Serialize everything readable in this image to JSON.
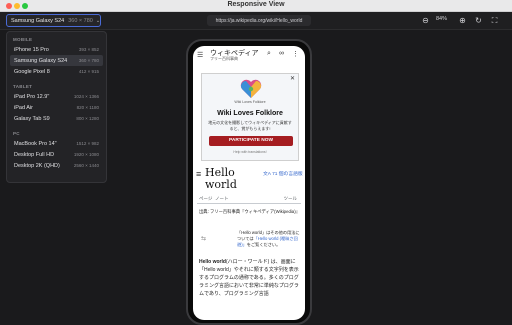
{
  "window": {
    "title": "Responsive View"
  },
  "toolbar": {
    "device_name": "Samsung Galaxy S24",
    "device_res": "360 × 780",
    "url": "https://ja.wikipedia.org/wiki/Hello_world",
    "zoom": "84%"
  },
  "dropdown": {
    "groups": [
      {
        "label": "MOBILE",
        "items": [
          {
            "name": "iPhone 15 Pro",
            "res": "393 × 852"
          },
          {
            "name": "Samsung Galaxy S24",
            "res": "360 × 780"
          },
          {
            "name": "Google Pixel 8",
            "res": "412 × 915"
          }
        ]
      },
      {
        "label": "TABLET",
        "items": [
          {
            "name": "iPad Pro 12.9\"",
            "res": "1024 × 1366"
          },
          {
            "name": "iPad Air",
            "res": "820 × 1180"
          },
          {
            "name": "Galaxy Tab S9",
            "res": "800 × 1280"
          }
        ]
      },
      {
        "label": "PC",
        "items": [
          {
            "name": "MacBook Pro 14\"",
            "res": "1512 × 982"
          },
          {
            "name": "Desktop Full HD",
            "res": "1920 × 1080"
          },
          {
            "name": "Desktop 2K (QHD)",
            "res": "2560 × 1440"
          }
        ]
      }
    ]
  },
  "wiki": {
    "logo": "ウィキペディア",
    "logo_sub": "フリー百科事典",
    "banner": {
      "small_label": "Wiki Loves Folklore",
      "title": "Wiki Loves Folklore",
      "text": "地元の文化を撮影してウィキペディアに貢献すると、賞がもらえます!",
      "button": "PARTICIPATE NOW",
      "help": "Help with translations!"
    },
    "article_title": "Hello world",
    "lang_link": "71 個の言語版",
    "tab_page": "ページ",
    "tab_note": "ノート",
    "tab_tools": "ツール",
    "source": "出典: フリー百科事典『ウィキペディア(Wikipedia)』",
    "hatnote_pre": "「Hello world」はその他の用法については",
    "hatnote_link": "「Hello world (曖昧さ回避)」",
    "hatnote_post": "をご覧ください。",
    "body_bold": "Hello world",
    "body_1": "(ハロー・ワールド) は、画面に「Hello world」やそれに類する文字列を表示するプログラムの通称である。多くのプログラミング言語において非常に単純なプログラムであり、プログラミング言語"
  }
}
